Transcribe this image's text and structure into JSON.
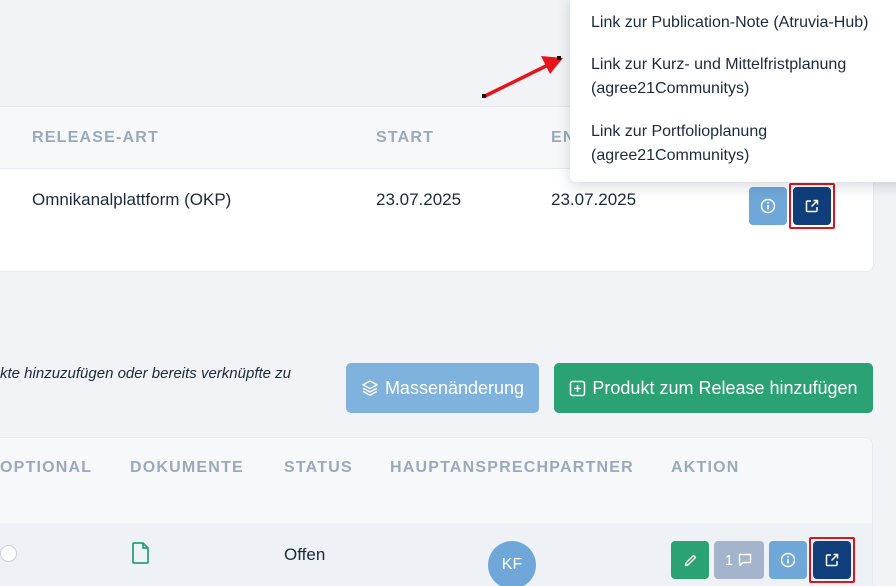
{
  "release_table": {
    "headers": {
      "type": "RELEASE-ART",
      "start": "START",
      "end": "EN"
    },
    "row": {
      "type": "Omnikanalplattform (OKP)",
      "start": "23.07.2025",
      "end": "23.07.2025"
    },
    "actions": [
      "info-icon",
      "external-link-icon"
    ]
  },
  "link_menu": {
    "items": [
      {
        "label": "Link zur Publication-Note (Atruvia-Hub)"
      },
      {
        "label": "Link zur Kurz- und Mittelfristplanung (agree21Communitys)"
      },
      {
        "label": "Link zur Portfolioplanung (agree21Communitys)"
      }
    ]
  },
  "toolbar": {
    "hint": "kte hinzuzufügen oder bereits verknüpfte zu",
    "mass_change_label": "Massenänderung",
    "mass_change_icon": "layers-icon",
    "add_product_label": "Produkt zum Release hinzufügen",
    "add_product_icon": "plus-square-icon"
  },
  "products_table": {
    "headers": {
      "optional": "OPTIONAL",
      "documents": "DOKUMENTE",
      "status": "STATUS",
      "contact": "HAUPTANSPRECHPARTNER",
      "action": "AKTION"
    },
    "row": {
      "document_icon": "file-icon",
      "status": "Offen",
      "contact_initials": "KF",
      "comment_count": "1"
    }
  },
  "colors": {
    "info_button": "#6fa8d8",
    "link_button": "#0f3e7a",
    "edit_button": "#2aa274",
    "comment_button": "#a3b4cc",
    "highlight_frame": "#d9161c",
    "annotation_arrow": "#e8141b"
  }
}
